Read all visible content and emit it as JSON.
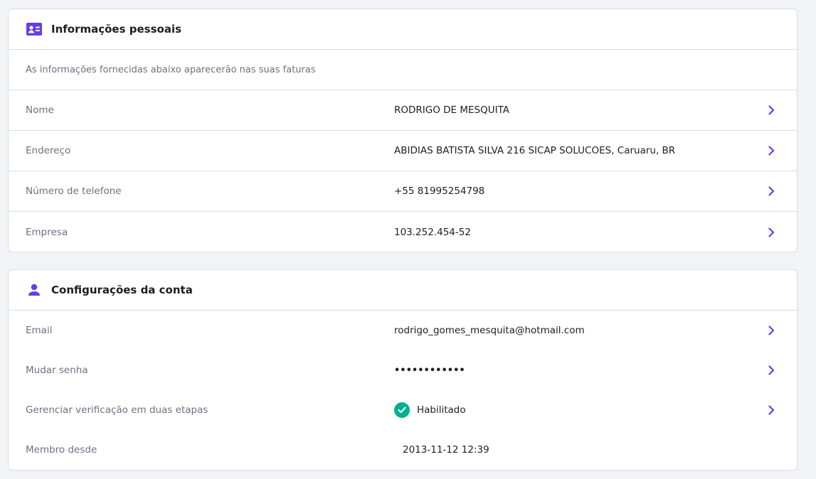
{
  "personal": {
    "title": "Informações pessoais",
    "icon": "id-card-icon",
    "subtitle": "As informações fornecidas abaixo aparecerão nas suas faturas",
    "rows": [
      {
        "label": "Nome",
        "value": "RODRIGO DE MESQUITA"
      },
      {
        "label": "Endereço",
        "value": "ABIDIAS BATISTA SILVA 216 SICAP SOLUCOES, Caruaru, BR"
      },
      {
        "label": "Número de telefone",
        "value": "+55 81995254798"
      },
      {
        "label": "Empresa",
        "value": "103.252.454-52"
      }
    ]
  },
  "account": {
    "title": "Configurações da conta",
    "icon": "user-icon",
    "rows": [
      {
        "label": "Email",
        "value": "rodrigo_gomes_mesquita@hotmail.com"
      },
      {
        "label": "Mudar senha",
        "value": "••••••••••••"
      },
      {
        "label": "Gerenciar verificação em duas etapas",
        "value": "Habilitado"
      },
      {
        "label": "Membro desde",
        "value": "2013-11-12 12:39"
      }
    ]
  },
  "colors": {
    "accent": "#673de6",
    "success": "#00b090",
    "border": "#dadce0",
    "background": "#f2f3f6"
  }
}
